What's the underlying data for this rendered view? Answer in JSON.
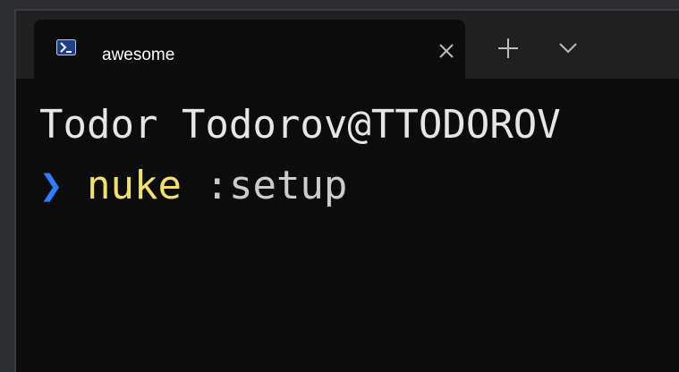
{
  "tab": {
    "icon": "powershell-icon",
    "title": "awesome",
    "close_icon": "close-icon"
  },
  "toolbar": {
    "new_tab_icon": "plus-icon",
    "dropdown_icon": "chevron-down-icon"
  },
  "terminal": {
    "user_host": "Todor Todorov@TTODOROV",
    "prompt_symbol": "❯",
    "command": "nuke",
    "arguments": ":setup"
  },
  "colors": {
    "background": "#0c0c0c",
    "tabbar": "#202020",
    "prompt": "#2e7bff",
    "command": "#f1e06a",
    "text": "#cccccc"
  }
}
